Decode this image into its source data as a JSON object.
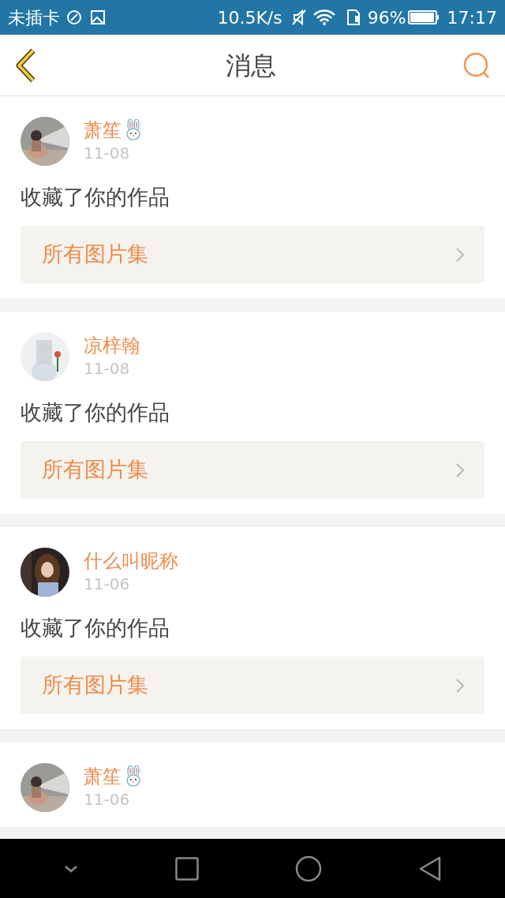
{
  "status_bar": {
    "carrier": "未插卡",
    "speed": "10.5K/s",
    "battery": "96%",
    "time": "17:17"
  },
  "header": {
    "title": "消息"
  },
  "messages": [
    {
      "name": "萧笙",
      "rabbit": true,
      "date": "11-08",
      "text": "收藏了你的作品",
      "link": "所有图片集"
    },
    {
      "name": "凉梓翰",
      "rabbit": false,
      "date": "11-08",
      "text": "收藏了你的作品",
      "link": "所有图片集"
    },
    {
      "name": "什么叫昵称",
      "rabbit": false,
      "date": "11-06",
      "text": "收藏了你的作品",
      "link": "所有图片集"
    },
    {
      "name": "萧笙",
      "rabbit": true,
      "date": "11-06"
    }
  ]
}
